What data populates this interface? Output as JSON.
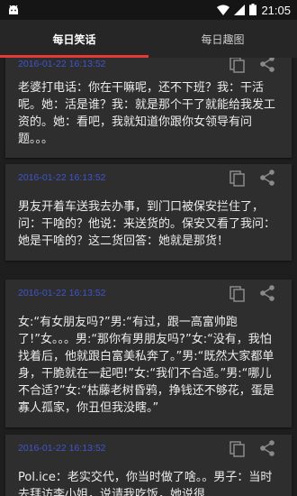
{
  "status_bar": {
    "time": "21:05",
    "icons": [
      "android-notification-icon",
      "wifi-icon",
      "signal-icon",
      "battery-icon"
    ]
  },
  "tabs": [
    {
      "label": "每日笑话",
      "active": true
    },
    {
      "label": "每日趣图",
      "active": false
    }
  ],
  "colors": {
    "accent": "#e53935",
    "timestamp": "#3f56c9",
    "card_bg": "#2e2e2e",
    "page_bg": "#1e1e1e"
  },
  "jokes": [
    {
      "time": "2016-01-22 16:13:52",
      "text": "老婆打电话：你在干嘛呢，还不下班？我：干活呢。她：活是谁？我：就是那个干了就能给我发工资的。她：看吧，我就知道你跟你女领导有问题。。。"
    },
    {
      "time": "2016-01-22 16:13:52",
      "text": "男友开着车送我去办事，到门口被保安拦住了，问：干啥的？他说：来送货的。保安又看了我问：她是干啥的？这二货回答：她就是那货！"
    },
    {
      "time": "2016-01-22 16:13:52",
      "text": "女:“有女朋友吗?”男:“有过，跟一高富帅跑了!”女。。。男:“那你有男朋友吗?”女:“没有，我怕找着后，他就跟白富美私奔了。”男:“既然大家都单身，干脆就在一起吧!”女:“我们不合适。”男:“哪儿不合适?”女:“枯藤老树昏鸦，挣钱还不够花，蛋是寡人孤家，你丑但我没瞎。”"
    },
    {
      "time": "2016-01-22 16:13:52",
      "text": "Pol.ice：老实交代，你当时做了啥。。男子：当时去拜访李小姐，说请我吃饭，她说很"
    }
  ]
}
